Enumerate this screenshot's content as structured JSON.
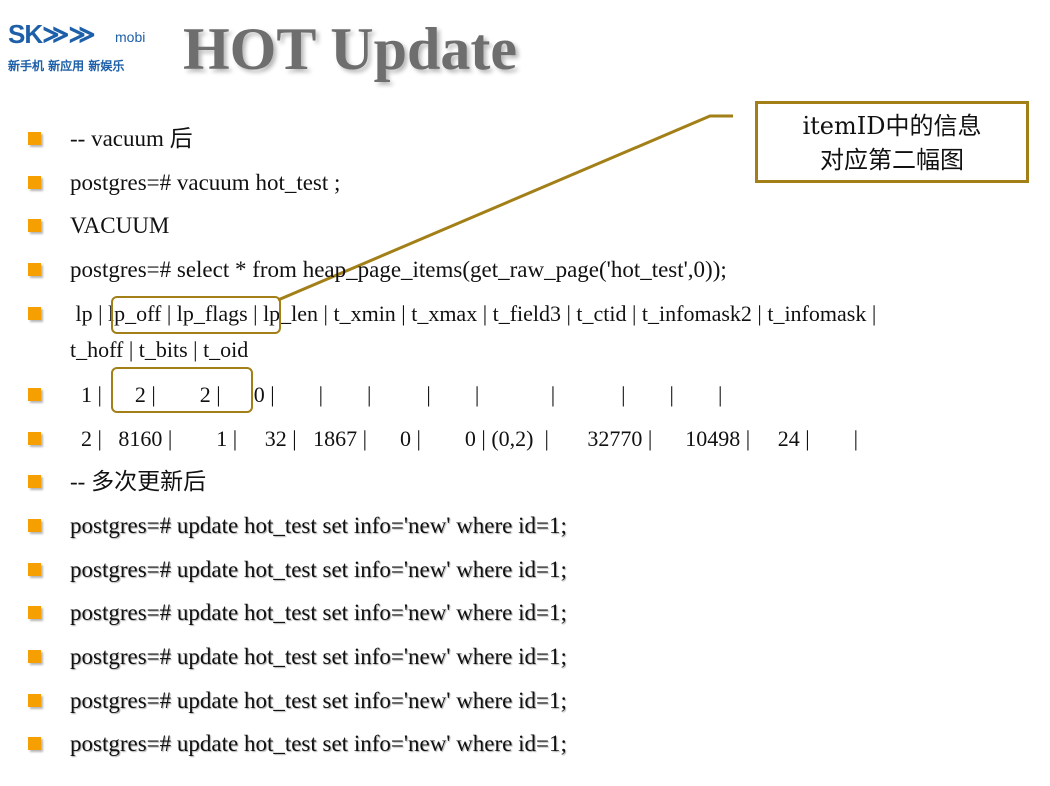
{
  "logo": {
    "brand": "SK≫≫",
    "brand_sub": "mobi",
    "tagline": "新手机 新应用 新娱乐"
  },
  "title": "HOT Update",
  "callout": {
    "line1": "itemID中的信息",
    "line2": "对应第二幅图"
  },
  "accent_color": "#f5a000",
  "highlight_color": "#a27f17",
  "bullets": [
    {
      "text": "-- vacuum 后"
    },
    {
      "text": "postgres=# vacuum hot_test ;"
    },
    {
      "text": "VACUUM"
    },
    {
      "text": "postgres=# select * from heap_page_items(get_raw_page('hot_test',0));"
    },
    {
      "text": " lp | lp_off | lp_flags | lp_len | t_xmin | t_xmax | t_field3 | t_ctid | t_infomask2 | t_infomask |",
      "text2": "t_hoff | t_bits | t_oid"
    },
    {
      "text": "  1 |      2 |        2 |      0 |        |        |          |        |             |            |        |        |"
    },
    {
      "text": "  2 |   8160 |        1 |     32 |   1867 |      0 |        0 | (0,2)  |       32770 |      10498 |     24 |        |"
    },
    {
      "text": "-- 多次更新后"
    },
    {
      "text": "postgres=# update hot_test set info='new' where id=1;"
    },
    {
      "text": "postgres=# update hot_test set info='new' where id=1;"
    },
    {
      "text": "postgres=# update hot_test set info='new' where id=1;"
    },
    {
      "text": "postgres=# update hot_test set info='new' where id=1;"
    },
    {
      "text": "postgres=# update hot_test set info='new' where id=1;"
    },
    {
      "text": "postgres=# update hot_test set info='new' where id=1;"
    }
  ]
}
